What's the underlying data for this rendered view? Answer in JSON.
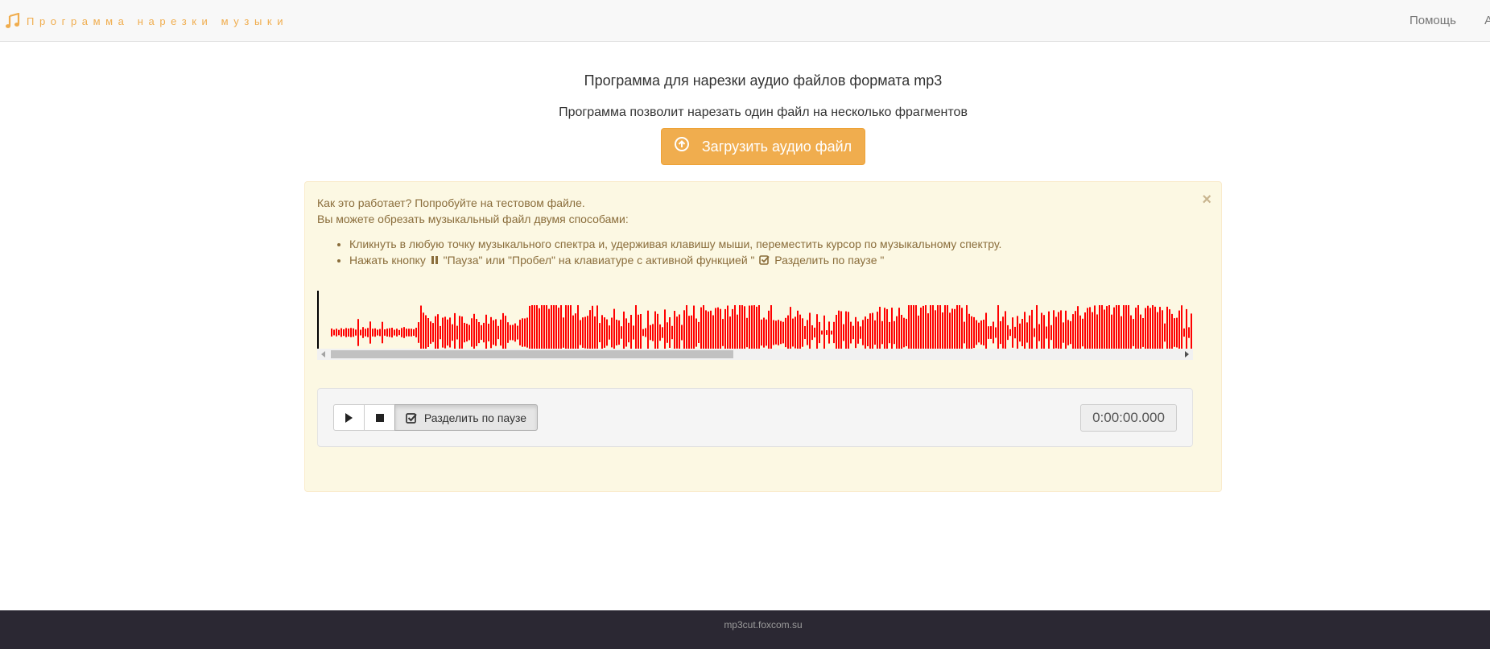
{
  "navbar": {
    "brand": "Программа нарезки музыки",
    "links": [
      "Помощь",
      "Ар"
    ]
  },
  "header": {
    "title": "Программа для нарезки аудио файлов формата mp3",
    "subtitle": "Программа позволит нарезать один файл на несколько фрагментов",
    "upload_label": "Загрузить аудио файл"
  },
  "help": {
    "line1": "Как это работает? Попробуйте на тестовом файле.",
    "line2": "Вы можете обрезать музыкальный файл двумя способами:",
    "item1": "Кликнуть в любую точку музыкального спектра и, удерживая клавишу мыши, переместить курсор по музыкальному спектру.",
    "item2_a": "Нажать кнопку",
    "item2_b": "\"Пауза\" или \"Пробел\" на клавиатуре с активной функцией \"",
    "item2_c": "Разделить по паузе \"",
    "close": "×"
  },
  "waveform": {
    "color": "#ff0000",
    "cursor_color": "#000000"
  },
  "player": {
    "split_label": "Разделить по паузе",
    "time": "0:00:00.000"
  },
  "footer": {
    "site": "mp3cut.foxcom.su"
  },
  "colors": {
    "accent": "#f0ad4e",
    "alert_bg": "#fcf8e3",
    "alert_text": "#8a6d3b",
    "footer_bg": "#2b2833"
  }
}
